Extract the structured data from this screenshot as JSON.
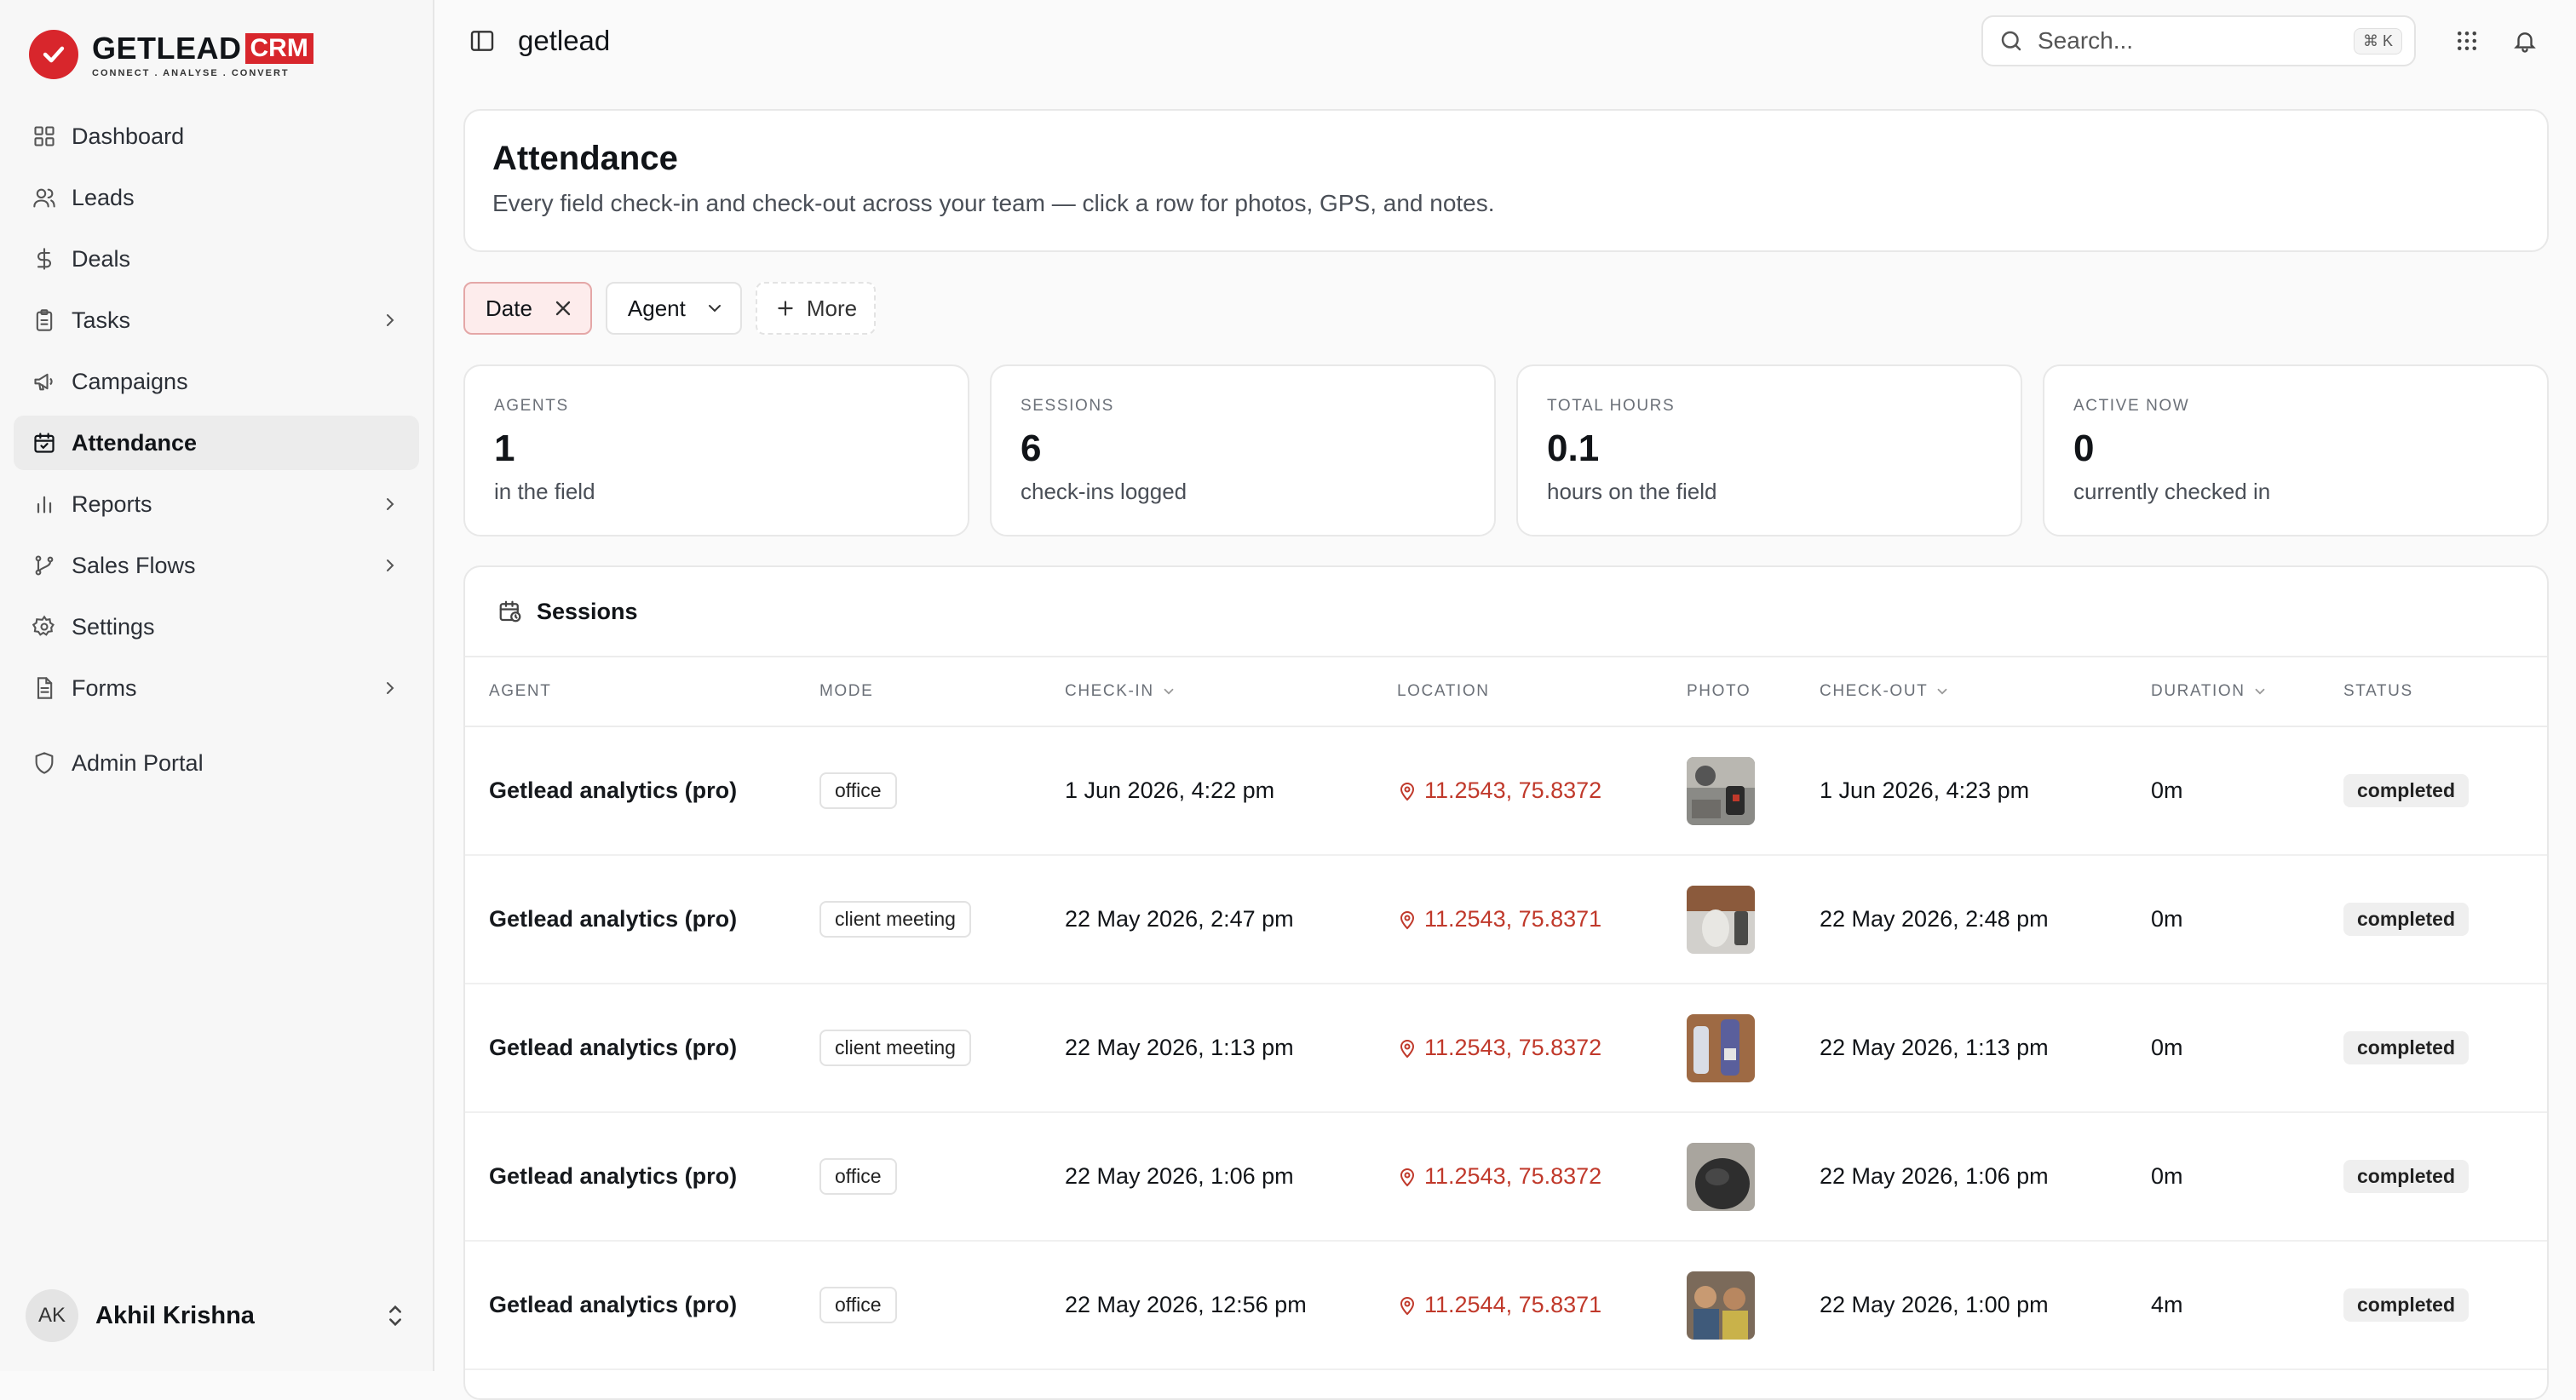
{
  "brand": {
    "name": "GETLEAD",
    "badge": "CRM",
    "tagline": "CONNECT . ANALYSE . CONVERT"
  },
  "sidebar": {
    "items": [
      {
        "label": "Dashboard",
        "icon": "grid-icon"
      },
      {
        "label": "Leads",
        "icon": "users-icon"
      },
      {
        "label": "Deals",
        "icon": "dollar-icon"
      },
      {
        "label": "Tasks",
        "icon": "clipboard-icon",
        "has_children": true
      },
      {
        "label": "Campaigns",
        "icon": "megaphone-icon"
      },
      {
        "label": "Attendance",
        "icon": "calendar-check-icon",
        "active": true
      },
      {
        "label": "Reports",
        "icon": "bar-chart-icon",
        "has_children": true
      },
      {
        "label": "Sales Flows",
        "icon": "git-branch-icon",
        "has_children": true
      },
      {
        "label": "Settings",
        "icon": "gear-icon"
      },
      {
        "label": "Forms",
        "icon": "document-icon",
        "has_children": true
      },
      {
        "label": "Admin Portal",
        "icon": "shield-icon"
      }
    ],
    "user": {
      "initials": "AK",
      "name": "Akhil Krishna"
    }
  },
  "header": {
    "org_name": "getlead",
    "search_placeholder": "Search...",
    "search_shortcut": "⌘ K"
  },
  "page": {
    "title": "Attendance",
    "subtitle": "Every field check-in and check-out across your team — click a row for photos, GPS, and notes."
  },
  "filters": {
    "date": "Date",
    "agent": "Agent",
    "more": "More"
  },
  "stats": [
    {
      "label": "AGENTS",
      "value": "1",
      "sub": "in the field"
    },
    {
      "label": "SESSIONS",
      "value": "6",
      "sub": "check-ins logged"
    },
    {
      "label": "TOTAL HOURS",
      "value": "0.1",
      "sub": "hours on the field"
    },
    {
      "label": "ACTIVE NOW",
      "value": "0",
      "sub": "currently checked in"
    }
  ],
  "sessions": {
    "title": "Sessions",
    "columns": {
      "agent": "AGENT",
      "mode": "MODE",
      "checkin": "CHECK-IN",
      "location": "LOCATION",
      "photo": "PHOTO",
      "checkout": "CHECK-OUT",
      "duration": "DURATION",
      "status": "STATUS"
    },
    "rows": [
      {
        "agent": "Getlead analytics (pro)",
        "mode": "office",
        "checkin": "1 Jun 2026, 4:22 pm",
        "location": "11.2543, 75.8372",
        "checkout": "1 Jun 2026, 4:23 pm",
        "duration": "0m",
        "status": "completed"
      },
      {
        "agent": "Getlead analytics (pro)",
        "mode": "client meeting",
        "checkin": "22 May 2026, 2:47 pm",
        "location": "11.2543, 75.8371",
        "checkout": "22 May 2026, 2:48 pm",
        "duration": "0m",
        "status": "completed"
      },
      {
        "agent": "Getlead analytics (pro)",
        "mode": "client meeting",
        "checkin": "22 May 2026, 1:13 pm",
        "location": "11.2543, 75.8372",
        "checkout": "22 May 2026, 1:13 pm",
        "duration": "0m",
        "status": "completed"
      },
      {
        "agent": "Getlead analytics (pro)",
        "mode": "office",
        "checkin": "22 May 2026, 1:06 pm",
        "location": "11.2543, 75.8372",
        "checkout": "22 May 2026, 1:06 pm",
        "duration": "0m",
        "status": "completed"
      },
      {
        "agent": "Getlead analytics (pro)",
        "mode": "office",
        "checkin": "22 May 2026, 12:56 pm",
        "location": "11.2544, 75.8371",
        "checkout": "22 May 2026, 1:00 pm",
        "duration": "4m",
        "status": "completed"
      }
    ]
  },
  "colors": {
    "brand_red": "#d8262c",
    "location_red": "#c0392b",
    "active_chip_bg": "#fdecec"
  }
}
